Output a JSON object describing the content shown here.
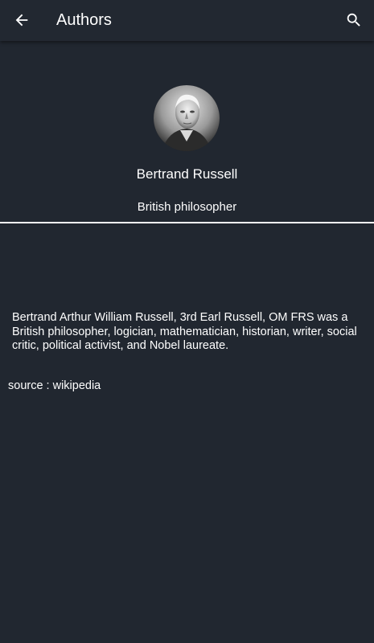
{
  "appbar": {
    "title": "Authors",
    "back_icon": "arrow-back-icon",
    "search_icon": "search-icon"
  },
  "author": {
    "name": "Bertrand Russell",
    "subtitle": "British philosopher",
    "bio": "Bertrand Arthur William Russell, 3rd Earl Russell, OM FRS was a British philosopher, logician, mathematician, historian, writer, social critic, political activist, and Nobel laureate.",
    "source": "source : wikipedia"
  },
  "colors": {
    "background": "#212730",
    "appbar": "#222831",
    "text": "#ffffff",
    "divider": "#ffffff"
  }
}
